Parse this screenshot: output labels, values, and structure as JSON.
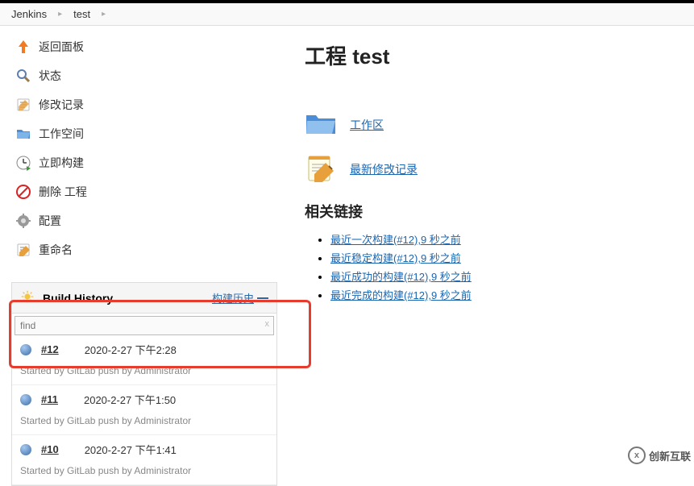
{
  "breadcrumb": {
    "items": [
      "Jenkins",
      "test"
    ]
  },
  "sidebar": {
    "items": [
      {
        "label": "返回面板",
        "icon": "up-arrow"
      },
      {
        "label": "状态",
        "icon": "magnifier"
      },
      {
        "label": "修改记录",
        "icon": "notepad"
      },
      {
        "label": "工作空间",
        "icon": "folder-blue"
      },
      {
        "label": "立即构建",
        "icon": "clock-play"
      },
      {
        "label": "删除 工程",
        "icon": "no-entry"
      },
      {
        "label": "配置",
        "icon": "gear"
      },
      {
        "label": "重命名",
        "icon": "rename"
      }
    ]
  },
  "build_history": {
    "title": "Build History",
    "trend_label": "构建历史",
    "find_value": "find",
    "find_clear": "x",
    "builds": [
      {
        "num": "#12",
        "date": "2020-2-27 下午2:28",
        "cause": "Started by GitLab push by Administrator"
      },
      {
        "num": "#11",
        "date": "2020-2-27 下午1:50",
        "cause": "Started by GitLab push by Administrator"
      },
      {
        "num": "#10",
        "date": "2020-2-27 下午1:41",
        "cause": "Started by GitLab push by Administrator"
      }
    ]
  },
  "main": {
    "title": "工程 test",
    "workspace_link": "工作区",
    "changes_link": "最新修改记录",
    "related_heading": "相关链接",
    "related_links": [
      "最近一次构建(#12),9 秒之前",
      "最近稳定构建(#12),9 秒之前",
      "最近成功的构建(#12),9 秒之前",
      "最近完成的构建(#12),9 秒之前"
    ]
  },
  "watermark": {
    "text": "创新互联",
    "badge": "x"
  }
}
